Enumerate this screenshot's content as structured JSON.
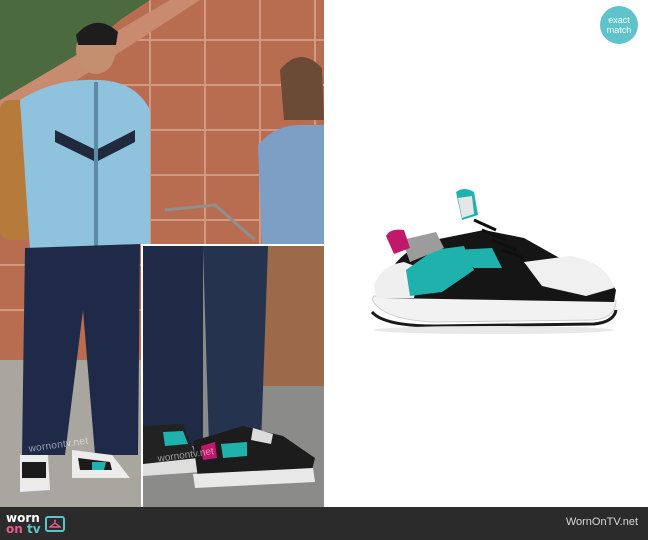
{
  "badge": {
    "line1": "exact",
    "line2": "match"
  },
  "watermark": {
    "photo": "wornontv.net",
    "inset": "wornontv.net"
  },
  "footer": {
    "logo_top": "worn",
    "logo_bottom": "on",
    "logo_accent": "tv",
    "site": "WornOnTV.net"
  },
  "colors": {
    "accent_teal": "#5ec3cb",
    "accent_pink": "#e35d8f",
    "footer_bg": "#2b2b2b",
    "sneaker_teal": "#1fb2ad",
    "sneaker_magenta": "#c0186a"
  },
  "icons": {
    "tv": "tv-icon",
    "hanger": "hanger-icon"
  }
}
